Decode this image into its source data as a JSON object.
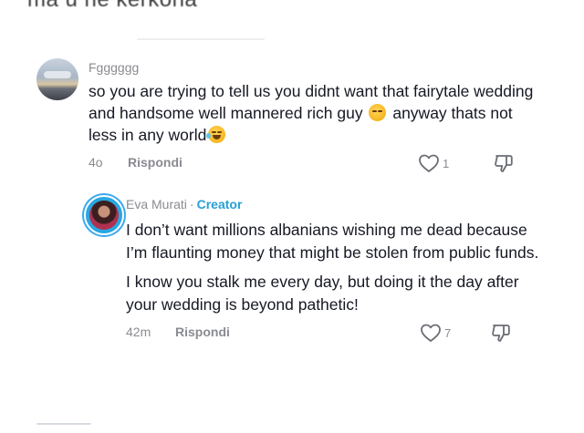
{
  "cut_off_top_text": "ma u ne kerkona",
  "comments": [
    {
      "username": "Fgggggg",
      "text_parts": [
        "so you are trying to tell us you didnt want that fairytale wedding and handsome well mannered rich guy",
        "anyway thats not less in any world"
      ],
      "emojis": [
        "unamused-face",
        "tears-of-joy-face"
      ],
      "time": "4o",
      "reply_label": "Rispondi",
      "like_count": "1"
    },
    {
      "username": "Eva Murati",
      "separator": "·",
      "badge": "Creator",
      "paragraphs": [
        "I don’t want millions albanians wishing me dead because I’m flaunting money that might be stolen from public funds.",
        "I know you stalk me every day, but doing it the day after your wedding is beyond pathetic!"
      ],
      "time": "42m",
      "reply_label": "Rispondi",
      "like_count": "7"
    }
  ],
  "icons": {
    "like": "heart-outline-icon",
    "dislike": "thumbs-down-outline-icon"
  },
  "colors": {
    "creator_badge": "#27a0d6",
    "meta_text": "#8a8b91",
    "body_text": "#161823"
  }
}
